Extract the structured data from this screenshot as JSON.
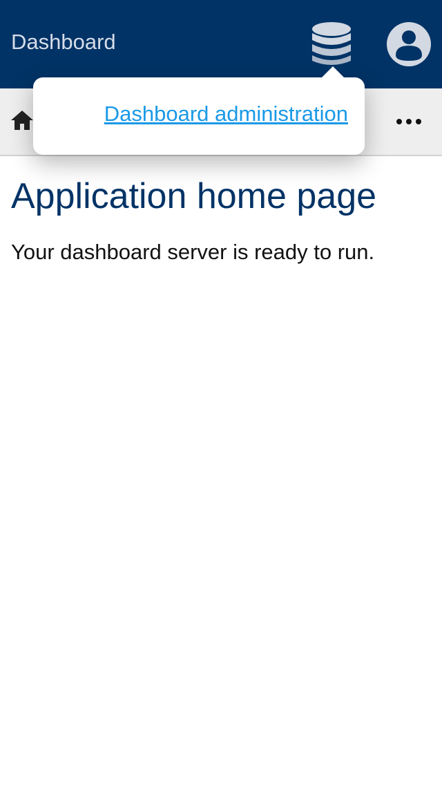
{
  "header": {
    "title": "Dashboard",
    "icons": [
      "database-icon",
      "account-circle-icon"
    ],
    "background_color": "#013366"
  },
  "navbar": {
    "icons": [
      "home-icon",
      "more-horizontal-icon"
    ],
    "background_color": "#eeeeee"
  },
  "popover": {
    "link_label": "Dashboard administration",
    "link_color": "#1a99e6"
  },
  "main": {
    "heading": "Application home page",
    "body_text": "Your dashboard server is ready to run.",
    "heading_color": "#013366"
  }
}
